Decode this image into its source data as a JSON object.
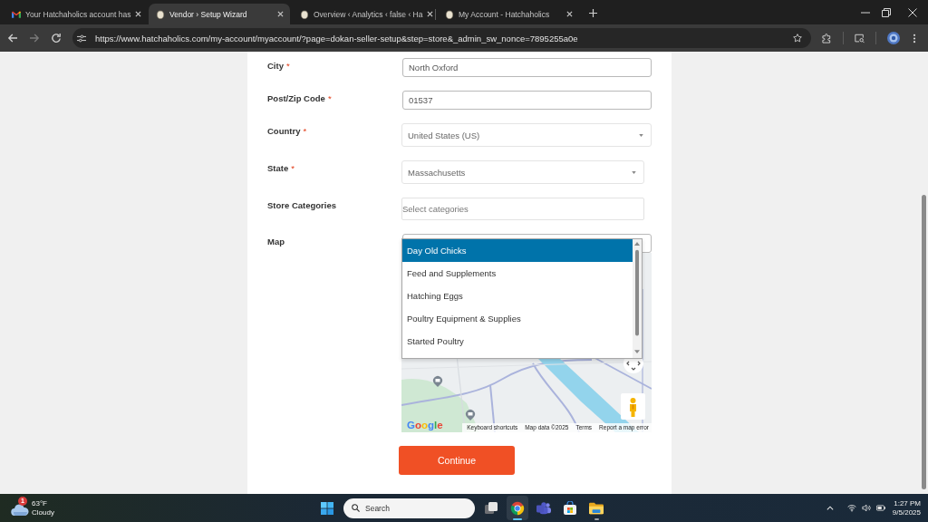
{
  "browser": {
    "tabs": [
      {
        "kind": "mail",
        "title": "Your Hatchaholics account has",
        "selected": false
      },
      {
        "kind": "site",
        "title": "Vendor › Setup Wizard",
        "selected": true
      },
      {
        "kind": "site",
        "title": "Overview ‹ Analytics ‹ false ‹ Ha",
        "selected": false
      },
      {
        "kind": "site",
        "title": "My Account - Hatchaholics",
        "selected": false
      }
    ],
    "navigation": {
      "back_disabled": false,
      "forward_disabled": true
    },
    "address_bar": {
      "url": "https://www.hatchaholics.com/my-account/myaccount/?page=dokan-seller-setup&step=store&_admin_sw_nonce=7895255a0e"
    }
  },
  "form": {
    "fields": [
      {
        "kind": "text",
        "label": "City",
        "required_mark": "*",
        "value": "North Oxford"
      },
      {
        "kind": "text",
        "label": "Post/Zip Code",
        "required_mark": "*",
        "value": "01537"
      },
      {
        "kind": "select",
        "label": "Country",
        "required_mark": "*",
        "value": "United States (US)"
      },
      {
        "kind": "select",
        "label": "State",
        "required_mark": "*",
        "value": "Massachusetts"
      },
      {
        "kind": "multiselect",
        "label": "Store Categories",
        "placeholder": "Select categories",
        "expanded": true,
        "options": [
          {
            "label": "Day Old Chicks",
            "selected": true
          },
          {
            "label": "Feed and Supplements",
            "selected": false
          },
          {
            "label": "Hatching Eggs",
            "selected": false
          },
          {
            "label": "Poultry Equipment & Supplies",
            "selected": false
          },
          {
            "label": "Started Poultry",
            "selected": false
          }
        ]
      },
      {
        "kind": "map",
        "label": "Map",
        "attribution": {
          "logo": "Google",
          "links": [
            "Keyboard shortcuts",
            "Map data ©2025",
            "Terms",
            "Report a map error"
          ]
        }
      }
    ],
    "submit_button": "Continue"
  },
  "taskbar": {
    "weather": {
      "badge": "1",
      "temperature": "63°F",
      "condition": "Cloudy"
    },
    "search": {
      "placeholder": "Search"
    },
    "apps": [
      {
        "kind": "taskview",
        "selected": false,
        "open": false
      },
      {
        "kind": "browser",
        "selected": true,
        "open": true
      },
      {
        "kind": "chat",
        "selected": false,
        "open": false
      },
      {
        "kind": "store",
        "selected": false,
        "open": false
      },
      {
        "kind": "folder",
        "selected": false,
        "open": true
      }
    ],
    "clock": {
      "time": "1:27 PM",
      "date": "9/5/2025"
    }
  }
}
